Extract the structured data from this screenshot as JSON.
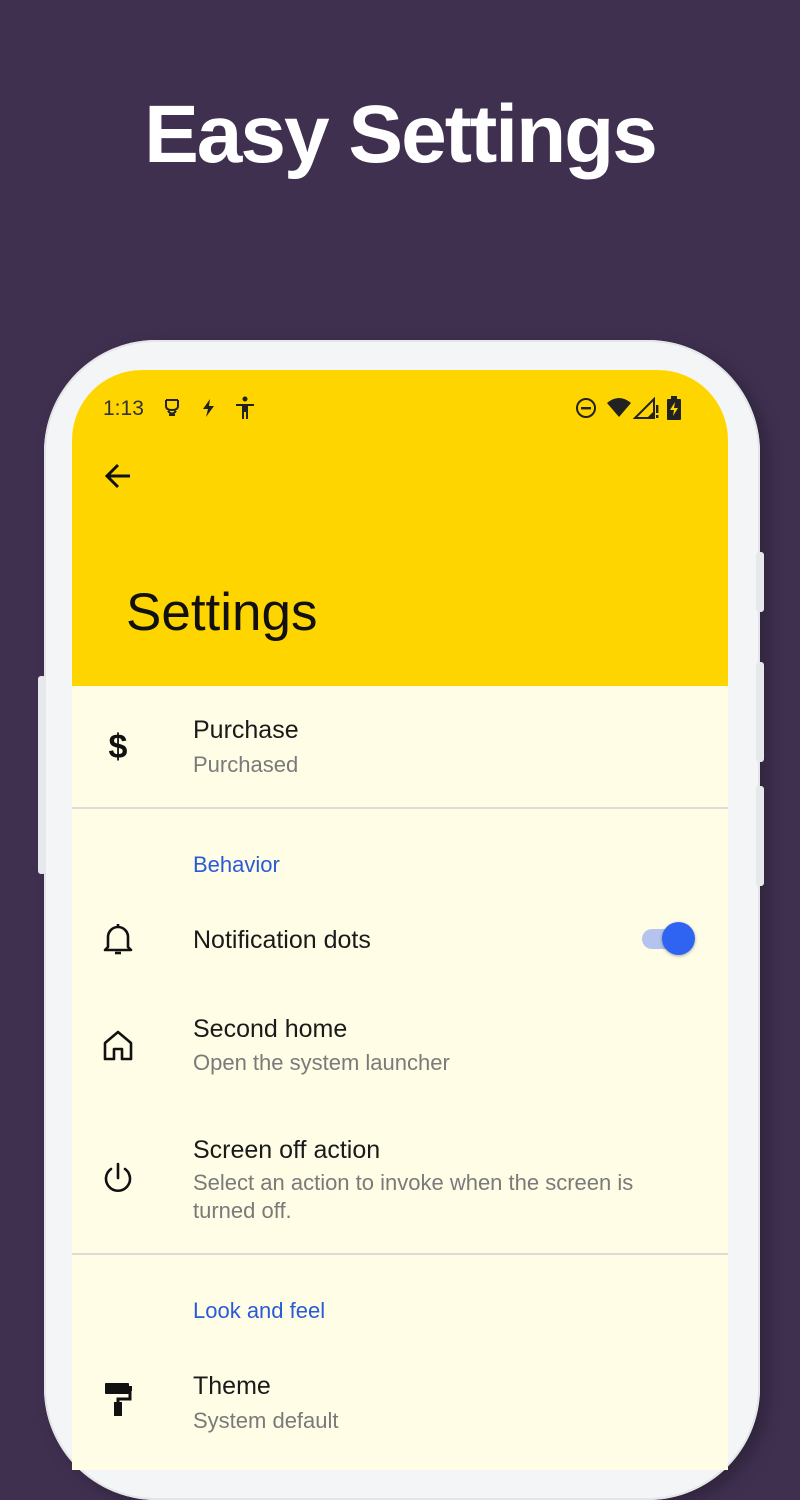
{
  "headline": "Easy Settings",
  "status_bar": {
    "time": "1:13",
    "left_icons": [
      "app-notification-icon",
      "flash-icon",
      "accessibility-icon"
    ],
    "right_icons": [
      "do-not-disturb-icon",
      "wifi-icon",
      "signal-icon",
      "battery-charging-icon"
    ]
  },
  "app_bar": {
    "back_icon": "arrow-back-icon",
    "title": "Settings",
    "color": "#ffd500"
  },
  "purchase": {
    "title": "Purchase",
    "subtitle": "Purchased",
    "icon": "dollar-icon"
  },
  "behavior": {
    "header": "Behavior",
    "notification_dots": {
      "title": "Notification dots",
      "icon": "bell-icon",
      "enabled": true
    },
    "second_home": {
      "title": "Second home",
      "subtitle": "Open the system launcher",
      "icon": "home-icon"
    },
    "screen_off": {
      "title": "Screen off action",
      "subtitle": "Select an action to invoke when the screen is turned off.",
      "icon": "power-icon"
    }
  },
  "look_and_feel": {
    "header": "Look and feel",
    "theme": {
      "title": "Theme",
      "subtitle": "System default",
      "icon": "paint-roller-icon"
    }
  },
  "colors": {
    "background": "#3f3050",
    "accent": "#2f64f2",
    "section_header": "#2a5bd7",
    "list_background": "#fffde6"
  }
}
